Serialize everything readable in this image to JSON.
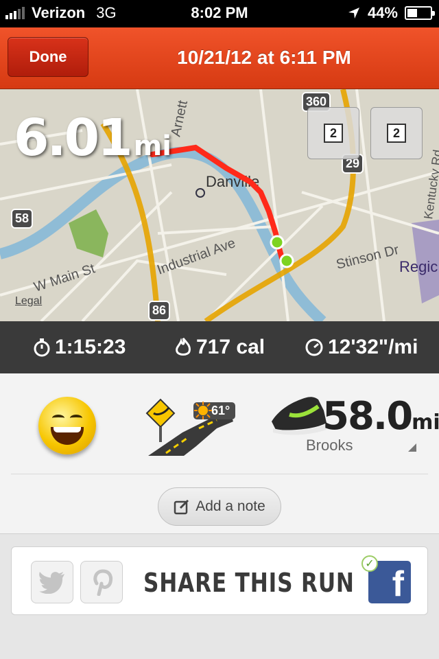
{
  "status_bar": {
    "carrier": "Verizon",
    "network": "3G",
    "time": "8:02 PM",
    "battery": "44%",
    "battery_level": 0.44
  },
  "header": {
    "done_label": "Done",
    "title": "10/21/12 at 6:11 PM"
  },
  "map": {
    "distance_value": "6.01",
    "distance_unit": "mi",
    "view_buttons": [
      "2",
      "2"
    ],
    "legal": "Legal",
    "street_labels": [
      "Danville",
      "Industrial Ave",
      "W Main St",
      "Stinson Dr",
      "Arnett",
      "Kentucky Rd",
      "Regic"
    ],
    "highway_labels": [
      "360",
      "29",
      "58",
      "86"
    ],
    "route_color": "#ff2a1a",
    "marker_color": "#7ed321"
  },
  "stats": {
    "duration": "1:15:23",
    "calories": "717 cal",
    "pace": "12'32\"/mi"
  },
  "details": {
    "mood_icon": "smile-emoji-icon",
    "terrain_icon": "road-terrain-icon",
    "weather_icon": "sunny-icon",
    "temperature": "61°",
    "shoe_miles_value": "58.0",
    "shoe_miles_unit": "mi",
    "shoe_name": "Brooks",
    "note_label": "Add a note"
  },
  "share": {
    "label": "SHARE THIS RUN",
    "twitter_icon": "twitter-icon",
    "pinterest_icon": "pinterest-icon",
    "facebook_icon": "facebook-icon",
    "facebook_letter": "f",
    "facebook_color": "#3b5998"
  }
}
